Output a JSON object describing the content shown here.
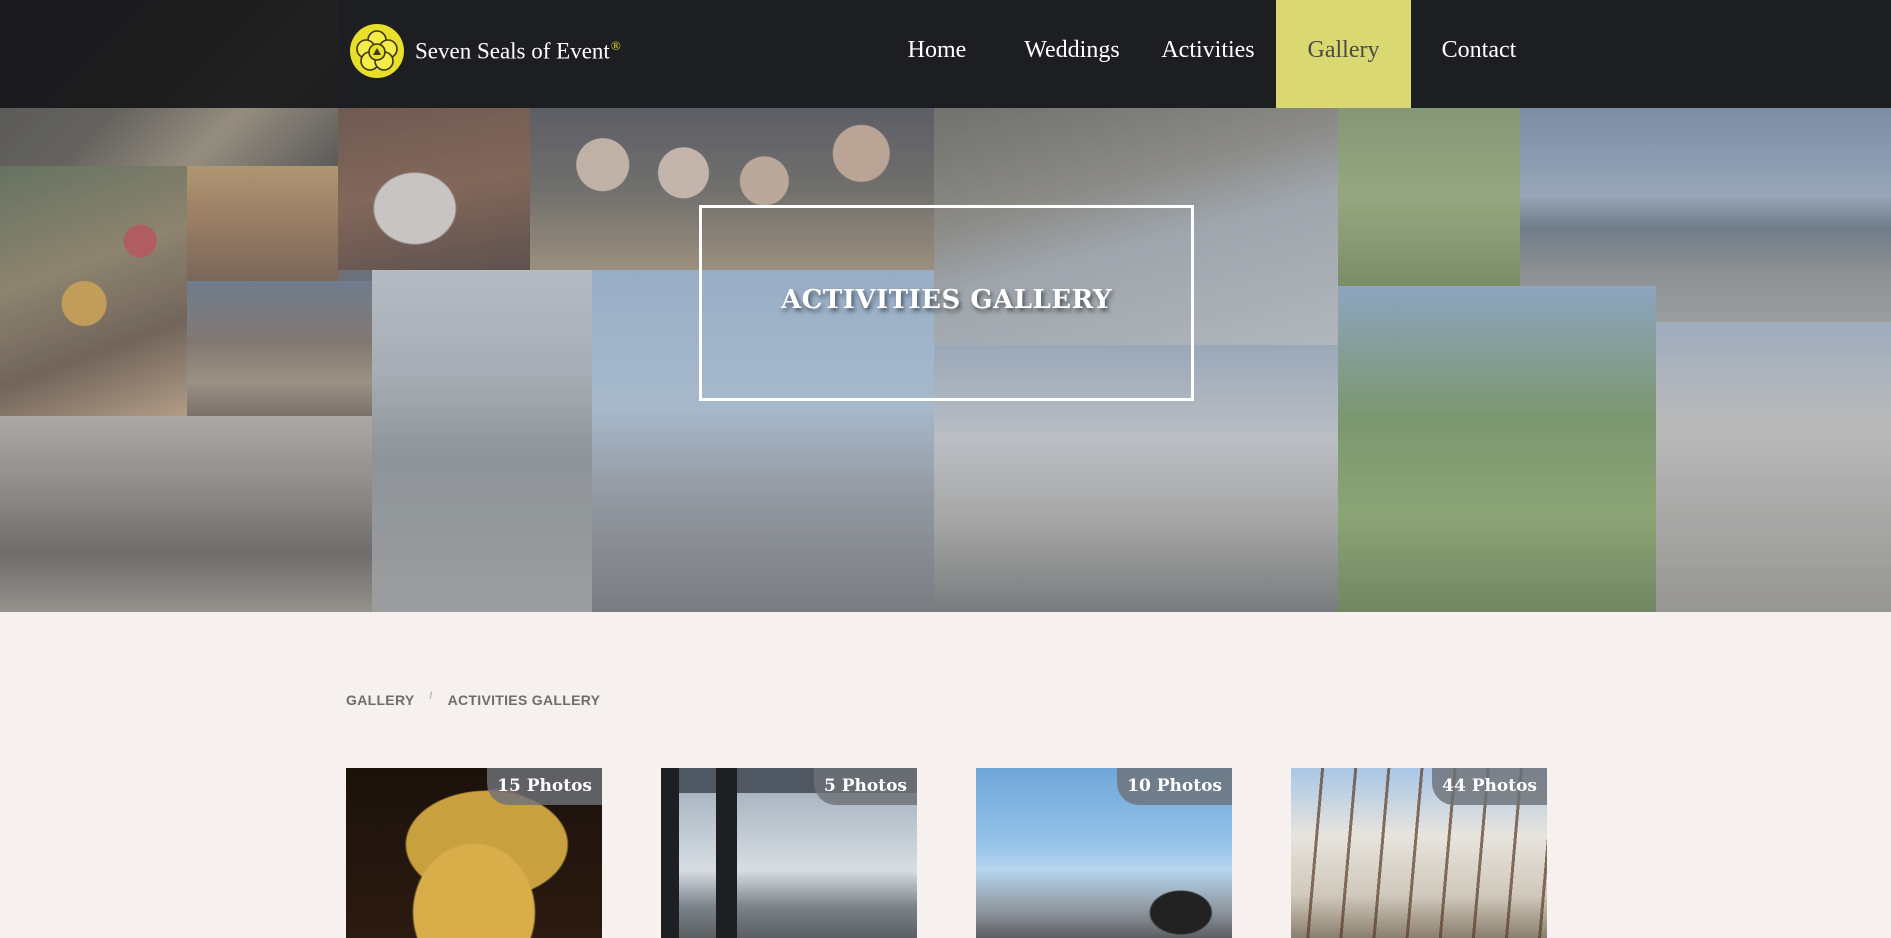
{
  "header": {
    "brand_name": "Seven Seals of Event",
    "brand_mark": "®",
    "logo_icon": "seal-emblem-icon",
    "nav": {
      "home": "Home",
      "weddings": "Weddings",
      "activities": "Activities",
      "gallery": "Gallery",
      "contact": "Contact"
    },
    "active_nav": "Gallery"
  },
  "hero": {
    "title": "ACTIVITIES GALLERY"
  },
  "breadcrumb": {
    "items": [
      "GALLERY",
      "ACTIVITIES GALLERY"
    ],
    "separator": "/"
  },
  "albums": [
    {
      "count_label": "15 Photos"
    },
    {
      "count_label": "5 Photos"
    },
    {
      "count_label": "10 Photos"
    },
    {
      "count_label": "44 Photos"
    }
  ],
  "colors": {
    "page_background": "#f6f1ef",
    "navbar_background": "#121214",
    "nav_active_background": "#dad870",
    "brand_accent": "#e8df2a"
  }
}
